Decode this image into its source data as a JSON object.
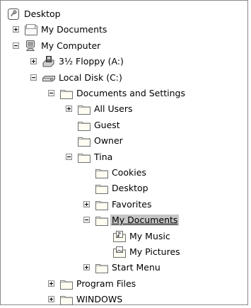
{
  "tree": {
    "items": [
      {
        "label": "Desktop",
        "icon": "desktop-icon",
        "level": 0,
        "expander": "none"
      },
      {
        "label": "My Documents",
        "icon": "my-documents-icon",
        "level": 1,
        "expander": "plus"
      },
      {
        "label": "My Computer",
        "icon": "my-computer-icon",
        "level": 1,
        "expander": "minus"
      },
      {
        "label": "3½ Floppy (A:)",
        "icon": "floppy-drive-icon",
        "level": 2,
        "expander": "plus"
      },
      {
        "label": "Local Disk (C:)",
        "icon": "hard-disk-icon",
        "level": 2,
        "expander": "minus"
      },
      {
        "label": "Documents and Settings",
        "icon": "folder-icon",
        "level": 3,
        "expander": "minus"
      },
      {
        "label": "All Users",
        "icon": "folder-icon",
        "level": 4,
        "expander": "plus"
      },
      {
        "label": "Guest",
        "icon": "folder-icon",
        "level": 4,
        "expander": "none"
      },
      {
        "label": "Owner",
        "icon": "folder-icon",
        "level": 4,
        "expander": "none"
      },
      {
        "label": "Tina",
        "icon": "folder-icon",
        "level": 4,
        "expander": "minus"
      },
      {
        "label": "Cookies",
        "icon": "folder-icon",
        "level": 5,
        "expander": "none"
      },
      {
        "label": "Desktop",
        "icon": "folder-icon",
        "level": 5,
        "expander": "none"
      },
      {
        "label": "Favorites",
        "icon": "folder-icon",
        "level": 5,
        "expander": "plus"
      },
      {
        "label": "My Documents",
        "icon": "folder-icon",
        "level": 5,
        "expander": "minus",
        "selected": true
      },
      {
        "label": "My Music",
        "icon": "my-music-icon",
        "level": 6,
        "expander": "none"
      },
      {
        "label": "My Pictures",
        "icon": "my-pictures-icon",
        "level": 6,
        "expander": "none"
      },
      {
        "label": "Start Menu",
        "icon": "folder-icon",
        "level": 5,
        "expander": "plus"
      },
      {
        "label": "Program Files",
        "icon": "folder-icon",
        "level": 3,
        "expander": "plus"
      },
      {
        "label": "WINDOWS",
        "icon": "folder-icon",
        "level": 3,
        "expander": "plus"
      }
    ]
  }
}
